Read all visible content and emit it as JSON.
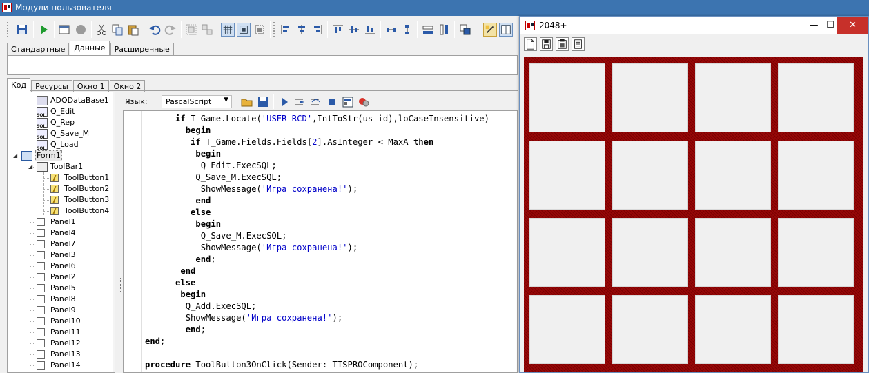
{
  "main_window": {
    "title": "Модули пользователя",
    "tabs_top": [
      "Стандартные",
      "Данные",
      "Расширенные"
    ],
    "tabs_top_active": 1,
    "tabs_bottom": [
      "Код",
      "Ресурсы",
      "Окно 1",
      "Окно 2"
    ],
    "tabs_bottom_active": 0
  },
  "tree": {
    "items": [
      {
        "label": "ADODataBase1",
        "icon": "database-icon",
        "level": 2
      },
      {
        "label": "Q_Edit",
        "icon": "sql-query-icon",
        "level": 2
      },
      {
        "label": "Q_Rep",
        "icon": "sql-query-icon",
        "level": 2
      },
      {
        "label": "Q_Save_M",
        "icon": "sql-query-icon",
        "level": 2
      },
      {
        "label": "Q_Load",
        "icon": "sql-query-icon",
        "level": 2
      },
      {
        "label": "Form1",
        "icon": "form-icon",
        "level": 1
      },
      {
        "label": "ToolBar1",
        "icon": "toolbar-icon",
        "level": 2
      },
      {
        "label": "ToolButton1",
        "icon": "toolbutton-icon",
        "level": 3
      },
      {
        "label": "ToolButton2",
        "icon": "toolbutton-icon",
        "level": 3
      },
      {
        "label": "ToolButton3",
        "icon": "toolbutton-icon",
        "level": 3
      },
      {
        "label": "ToolButton4",
        "icon": "toolbutton-icon",
        "level": 3
      },
      {
        "label": "Panel1",
        "icon": "panel-icon",
        "level": 2
      },
      {
        "label": "Panel4",
        "icon": "panel-icon",
        "level": 2
      },
      {
        "label": "Panel7",
        "icon": "panel-icon",
        "level": 2
      },
      {
        "label": "Panel3",
        "icon": "panel-icon",
        "level": 2
      },
      {
        "label": "Panel6",
        "icon": "panel-icon",
        "level": 2
      },
      {
        "label": "Panel2",
        "icon": "panel-icon",
        "level": 2
      },
      {
        "label": "Panel5",
        "icon": "panel-icon",
        "level": 2
      },
      {
        "label": "Panel8",
        "icon": "panel-icon",
        "level": 2
      },
      {
        "label": "Panel9",
        "icon": "panel-icon",
        "level": 2
      },
      {
        "label": "Panel10",
        "icon": "panel-icon",
        "level": 2
      },
      {
        "label": "Panel11",
        "icon": "panel-icon",
        "level": 2
      },
      {
        "label": "Panel12",
        "icon": "panel-icon",
        "level": 2
      },
      {
        "label": "Panel13",
        "icon": "panel-icon",
        "level": 2
      },
      {
        "label": "Panel14",
        "icon": "panel-icon",
        "level": 2
      }
    ]
  },
  "editor": {
    "language_label": "Язык:",
    "language_value": "PascalScript",
    "code_lines": [
      [
        {
          "t": "      "
        },
        {
          "t": "if",
          "c": "kw"
        },
        {
          "t": " T_Game.Locate("
        },
        {
          "t": "'USER_RCD'",
          "c": "str"
        },
        {
          "t": ",IntToStr(us_id),loCaseInsensitive)"
        }
      ],
      [
        {
          "t": "        "
        },
        {
          "t": "begin",
          "c": "kw"
        }
      ],
      [
        {
          "t": "         "
        },
        {
          "t": "if",
          "c": "kw"
        },
        {
          "t": " T_Game.Fields.Fields["
        },
        {
          "t": "2",
          "c": "num"
        },
        {
          "t": "].AsInteger < MaxA "
        },
        {
          "t": "then",
          "c": "kw"
        }
      ],
      [
        {
          "t": "          "
        },
        {
          "t": "begin",
          "c": "kw"
        }
      ],
      [
        {
          "t": "           Q_Edit.ExecSQL;"
        }
      ],
      [
        {
          "t": "          Q_Save_M.ExecSQL;"
        }
      ],
      [
        {
          "t": "           ShowMessage("
        },
        {
          "t": "'Игра сохранена!'",
          "c": "str"
        },
        {
          "t": ");"
        }
      ],
      [
        {
          "t": "          "
        },
        {
          "t": "end",
          "c": "kw"
        }
      ],
      [
        {
          "t": "         "
        },
        {
          "t": "else",
          "c": "kw"
        }
      ],
      [
        {
          "t": "          "
        },
        {
          "t": "begin",
          "c": "kw"
        }
      ],
      [
        {
          "t": "           Q_Save_M.ExecSQL;"
        }
      ],
      [
        {
          "t": "           ShowMessage("
        },
        {
          "t": "'Игра сохранена!'",
          "c": "str"
        },
        {
          "t": ");"
        }
      ],
      [
        {
          "t": "          "
        },
        {
          "t": "end",
          "c": "kw"
        },
        {
          "t": ";"
        }
      ],
      [
        {
          "t": "       "
        },
        {
          "t": "end",
          "c": "kw"
        }
      ],
      [
        {
          "t": "      "
        },
        {
          "t": "else",
          "c": "kw"
        }
      ],
      [
        {
          "t": "       "
        },
        {
          "t": "begin",
          "c": "kw"
        }
      ],
      [
        {
          "t": "        Q_Add.ExecSQL;"
        }
      ],
      [
        {
          "t": "        ShowMessage("
        },
        {
          "t": "'Игра сохранена!'",
          "c": "str"
        },
        {
          "t": ");"
        }
      ],
      [
        {
          "t": "        "
        },
        {
          "t": "end",
          "c": "kw"
        },
        {
          "t": ";"
        }
      ],
      [
        {
          "t": "end",
          "c": "kw"
        },
        {
          "t": ";"
        }
      ],
      [
        {
          "t": ""
        }
      ],
      [
        {
          "t": "procedure",
          "c": "kw"
        },
        {
          "t": " ToolButton3OnClick(Sender: TISPROComponent);"
        }
      ]
    ]
  },
  "game_window": {
    "title": "2048+",
    "minimize": "—",
    "maximize": "☐",
    "close": "✕",
    "toolbar_buttons": [
      "new-file-icon",
      "save-icon",
      "load-icon",
      "records-icon"
    ],
    "board_color": "#8b0000",
    "cells": [
      "",
      "",
      "",
      "",
      "",
      "",
      "",
      "",
      "",
      "",
      "",
      "",
      "",
      "",
      "",
      ""
    ]
  }
}
